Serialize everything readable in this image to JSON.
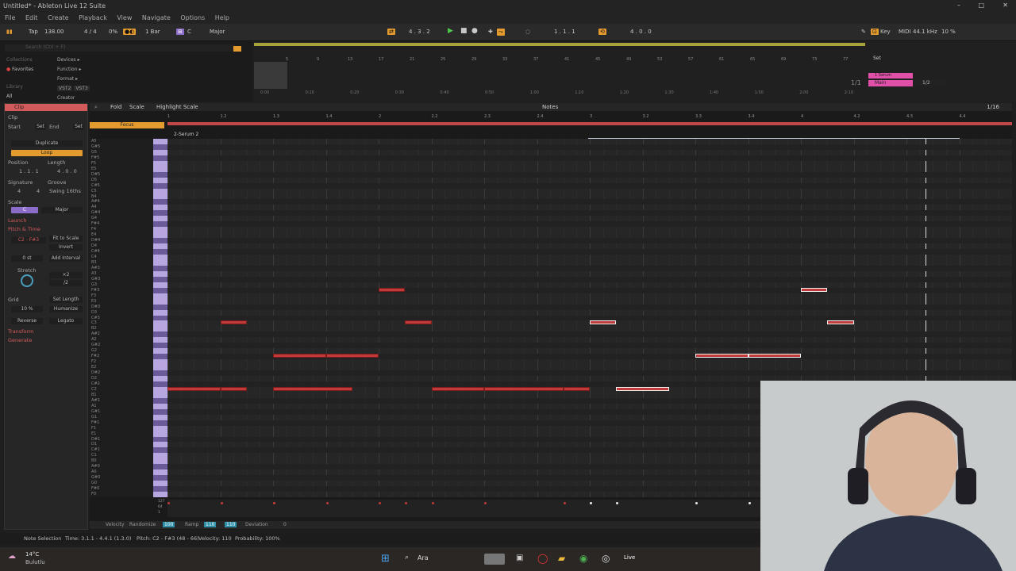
{
  "window": {
    "title": "Untitled* - Ableton Live 12 Suite"
  },
  "menu": [
    "File",
    "Edit",
    "Create",
    "Playback",
    "View",
    "Navigate",
    "Options",
    "Help"
  ],
  "transport": {
    "tap": "Tap",
    "tempo": "138.00",
    "signature": "4 / 4",
    "metronome_pct": "0%",
    "quantize": "1 Bar",
    "key": "C",
    "scale": "Major",
    "position": "4 . 3 . 2",
    "loop_start": "1 . 1 . 1",
    "loop_length": "4 . 0 . 0",
    "key_label": "Key",
    "midi_label": "MIDI",
    "sample_rate": "44.1 kHz",
    "cpu": "10 %"
  },
  "browser": {
    "search_placeholder": "Search (Ctrl + F)",
    "collections": "Collections",
    "favorites": "Favorites",
    "library": "Library",
    "all": "All",
    "items": [
      "Devices",
      "Function",
      "Format",
      "Creator"
    ],
    "tags": [
      "VST2",
      "VST3"
    ]
  },
  "arrangement": {
    "ruler": [
      "5",
      "9",
      "13",
      "17",
      "21",
      "25",
      "29",
      "33",
      "37",
      "41",
      "45",
      "49",
      "53",
      "57",
      "61",
      "65",
      "69",
      "73",
      "77"
    ],
    "times": [
      "0:00",
      "0:10",
      "0:20",
      "0:30",
      "0:40",
      "0:50",
      "1:00",
      "1:10",
      "1:20",
      "1:30",
      "1:40",
      "1:50",
      "2:00",
      "2:10"
    ],
    "set_label": "Set",
    "tracks": [
      "1 Serum",
      "Main"
    ],
    "track_slot": "1/1",
    "half": "1/2"
  },
  "clip_panel": {
    "title": "Clip",
    "clip": "Clip",
    "start": "Start",
    "set": "Set",
    "end": "End",
    "duplicate": "Duplicate",
    "loop": "Loop",
    "position": "Position",
    "length": "Length",
    "pos_value": "1 . 1 . 1",
    "len_value": "4 . 0 . 0",
    "signature": "Signature",
    "groove": "Groove",
    "sig_num": "4",
    "sig_den": "4",
    "groove_value": "Swing 16ths",
    "scale": "Scale",
    "scale_key": "C",
    "scale_name": "Major",
    "launch": "Launch",
    "pitch_time": "Pitch & Time",
    "range": "C2 - F#3",
    "fit": "Fit to Scale",
    "invert": "Invert",
    "interval": "0 st",
    "add_interval": "Add Interval",
    "stretch": "Stretch",
    "x2": "×2",
    "d2": "/2",
    "grid": "Grid",
    "set_length": "Set Length",
    "pct": "10 %",
    "humanize": "Humanize",
    "reverse": "Reverse",
    "legato": "Legato",
    "transform": "Transform",
    "generate": "Generate"
  },
  "editor": {
    "fold": "Fold",
    "scale": "Scale",
    "highlight": "Highlight Scale",
    "notes": "Notes",
    "focus": "Focus",
    "clip_name": "2-Serum 2",
    "zoom": "1/16",
    "bar_labels": [
      "1",
      "1.2",
      "1.3",
      "1.4",
      "2",
      "2.2",
      "2.3",
      "2.4",
      "3",
      "3.2",
      "3.3",
      "3.4",
      "4",
      "4.2",
      "4.3",
      "4.4"
    ],
    "keys": [
      "A5",
      "G#5",
      "G5",
      "F#5",
      "F5",
      "E5",
      "D#5",
      "D5",
      "C#5",
      "C5",
      "B4",
      "A#4",
      "A4",
      "G#4",
      "G4",
      "F#4",
      "F4",
      "E4",
      "D#4",
      "D4",
      "C#4",
      "C4",
      "B3",
      "A#3",
      "A3",
      "G#3",
      "G3",
      "F#3",
      "F3",
      "E3",
      "D#3",
      "D3",
      "C#3",
      "C3",
      "B2",
      "A#2",
      "A2",
      "G#2",
      "G2",
      "F#2",
      "F2",
      "E2",
      "D#2",
      "D2",
      "C#2",
      "C2",
      "B1",
      "A#1",
      "A1",
      "G#1",
      "G1",
      "F#1",
      "F1",
      "E1",
      "D#1",
      "D1",
      "C#1",
      "C1",
      "B0",
      "A#0",
      "A0",
      "G#0",
      "G0",
      "F#0",
      "F0"
    ],
    "notes_list": [
      {
        "pitch": "C2",
        "start": 1.0,
        "len": 0.5
      },
      {
        "pitch": "C2",
        "start": 1.5,
        "len": 0.25
      },
      {
        "pitch": "C3",
        "start": 1.5,
        "len": 0.25
      },
      {
        "pitch": "C2",
        "start": 2.0,
        "len": 0.75
      },
      {
        "pitch": "F#2",
        "start": 2.0,
        "len": 0.5
      },
      {
        "pitch": "F#2",
        "start": 2.5,
        "len": 0.5
      },
      {
        "pitch": "F#3",
        "start": 3.0,
        "len": 0.25
      },
      {
        "pitch": "C3",
        "start": 3.25,
        "len": 0.25
      },
      {
        "pitch": "C2",
        "start": 3.5,
        "len": 0.5
      },
      {
        "pitch": "C2",
        "start": 4.0,
        "len": 0.75
      },
      {
        "pitch": "C2",
        "start": 4.75,
        "len": 0.25
      },
      {
        "pitch": "C3",
        "start": 5.0,
        "len": 0.25
      },
      {
        "pitch": "C2",
        "start": 5.25,
        "len": 0.5
      },
      {
        "pitch": "F#2",
        "start": 6.0,
        "len": 0.5
      },
      {
        "pitch": "F#2",
        "start": 6.5,
        "len": 0.5
      },
      {
        "pitch": "F#3",
        "start": 7.0,
        "len": 0.25
      },
      {
        "pitch": "C3",
        "start": 7.25,
        "len": 0.25
      }
    ],
    "velocity_label": "Velocity",
    "randomize": "Randomize",
    "rand_value": "100",
    "ramp": "Ramp",
    "ramp_a": "110",
    "ramp_b": "110",
    "deviation": "Deviation",
    "dev_value": "0",
    "vel_max": "127",
    "vel_mid": "64",
    "vel_min": "1"
  },
  "status": {
    "mode": "Note Selection",
    "time": "Time: 3.1.1 - 4.4.1 (1.3.0)",
    "pitch": "Pitch: C2 - F#3 (48 - 66)",
    "velocity": "Velocity: 110",
    "probability": "Probability: 100%"
  },
  "taskbar": {
    "temp": "14°C",
    "weather": "Bulutlu",
    "search": "Ara",
    "live": "Live"
  },
  "colors": {
    "accent": "#e39a2e",
    "note": "#c23a3a",
    "clip_header": "#d35a5a",
    "pink_track": "#e04fa8"
  }
}
